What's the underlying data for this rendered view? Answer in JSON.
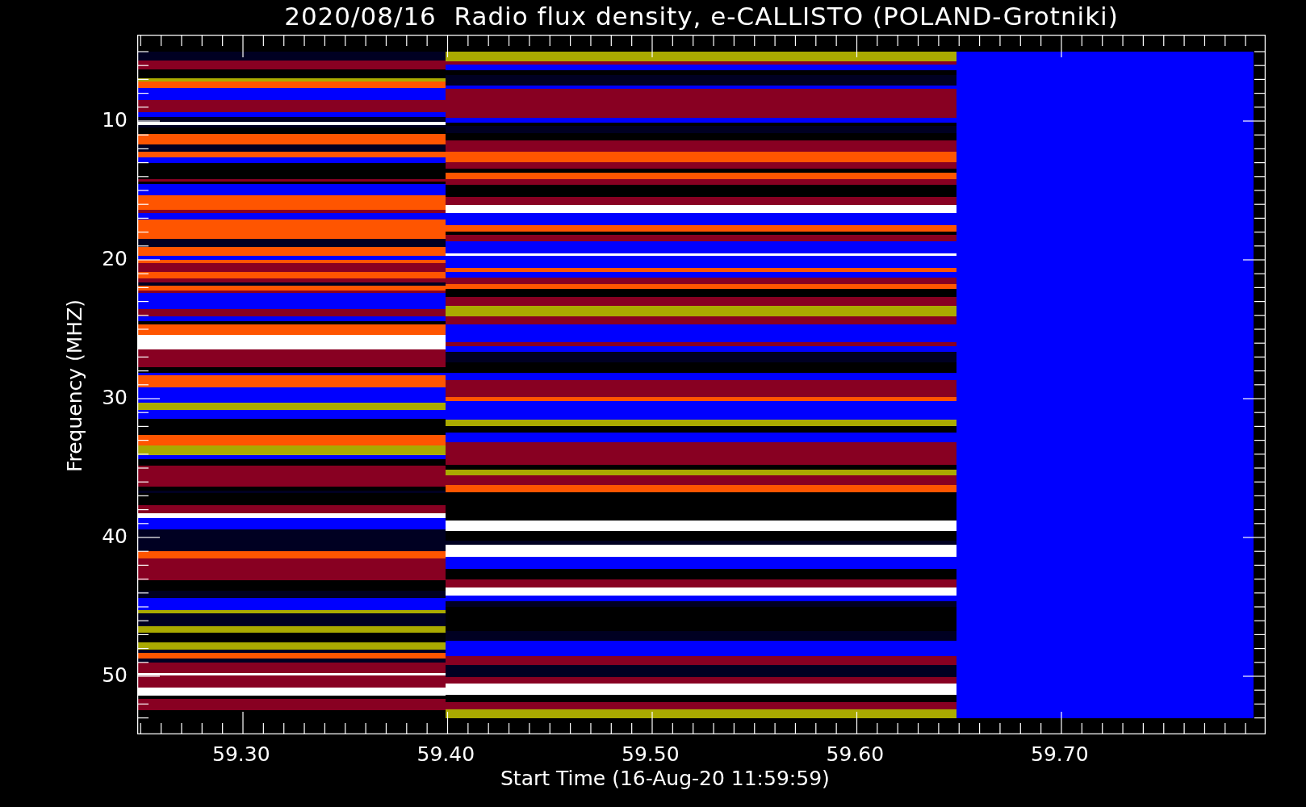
{
  "title": "2020/08/16  Radio flux density, e-CALLISTO (POLAND-Grotniki)",
  "y_axis": {
    "label": "Frequency (MHZ)",
    "ticks": [
      "10",
      "20",
      "30",
      "40",
      "50"
    ]
  },
  "x_axis": {
    "label": "Start Time (16-Aug-20 11:59:59)",
    "ticks": [
      "59.30",
      "59.40",
      "59.50",
      "59.60",
      "59.70"
    ]
  }
}
